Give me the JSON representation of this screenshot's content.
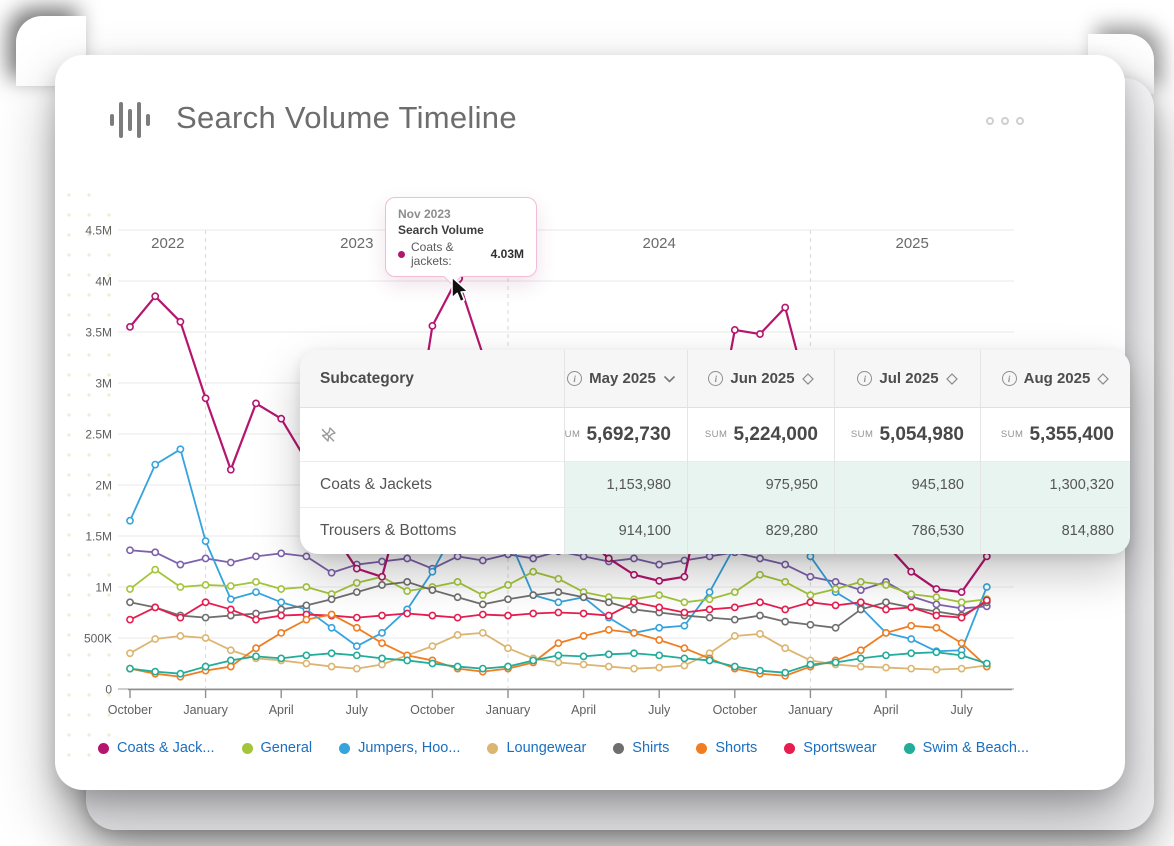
{
  "window": {
    "title": "Search Volume Timeline",
    "title_icon": "waveform-icon",
    "menu_icon": "three-dots-menu"
  },
  "tooltip": {
    "date": "Nov 2023",
    "label": "Search Volume",
    "series": "Coats & jackets:",
    "value": "4.03M",
    "accent_color": "#b5156e"
  },
  "table": {
    "first_column_header": "Subcategory",
    "sum_label": "SUM",
    "columns": [
      {
        "label": "May 2025",
        "sort_icon": "chevron-down",
        "sum": "5,692,730"
      },
      {
        "label": "Jun 2025",
        "sort_icon": "diamond-sort",
        "sum": "5,224,000"
      },
      {
        "label": "Jul 2025",
        "sort_icon": "diamond-sort",
        "sum": "5,054,980"
      },
      {
        "label": "Aug 2025",
        "sort_icon": "diamond-sort",
        "sum": "5,355,400"
      }
    ],
    "rows": [
      {
        "name": "Coats & Jackets",
        "values": [
          "1,153,980",
          "975,950",
          "945,180",
          "1,300,320"
        ]
      },
      {
        "name": "Trousers & Bottoms",
        "values": [
          "914,100",
          "829,280",
          "786,530",
          "814,880"
        ]
      }
    ]
  },
  "legend": {
    "items": [
      {
        "label": "Coats & Jack...",
        "color": "#b5156e"
      },
      {
        "label": "General",
        "color": "#a3c53a"
      },
      {
        "label": "Jumpers, Hoo...",
        "color": "#35a3dd"
      },
      {
        "label": "Loungewear",
        "color": "#dcb571"
      },
      {
        "label": "Shirts",
        "color": "#6f6f6f"
      },
      {
        "label": "Shorts",
        "color": "#ef7e23"
      },
      {
        "label": "Sportswear",
        "color": "#e61e50"
      },
      {
        "label": "Swim & Beach...",
        "color": "#23ac99"
      }
    ]
  },
  "chart_data": {
    "type": "line",
    "title": "Search Volume Timeline",
    "ylabel": "Search Volume",
    "ylim": [
      0,
      4500000
    ],
    "values_unit": "millions",
    "grid": true,
    "y_tick_labels": [
      "4.5M",
      "4M",
      "3.5M",
      "3M",
      "2.5M",
      "2M",
      "1.5M",
      "1M",
      "500K",
      "0"
    ],
    "x_tick_labels": [
      "October",
      "January",
      "April",
      "July",
      "October",
      "January",
      "April",
      "July",
      "October",
      "January",
      "April",
      "July"
    ],
    "year_labels": [
      "2022",
      "2023",
      "2024",
      "2025"
    ],
    "x_start_month": "Oct 2022",
    "x_end_month": "Aug 2025",
    "highlight_point": {
      "series": "Coats & Jackets",
      "month": "Nov 2023",
      "value_m": 4.03
    },
    "series": [
      {
        "name": "Coats & Jackets",
        "color": "#b5156e",
        "width": 2.2,
        "values_m": [
          3.55,
          3.85,
          3.6,
          2.85,
          2.15,
          2.8,
          2.65,
          2.24,
          1.55,
          1.18,
          1.1,
          2.0,
          3.56,
          4.03,
          3.28,
          2.6,
          2.05,
          1.72,
          1.5,
          1.28,
          1.12,
          1.06,
          1.1,
          2.2,
          3.52,
          3.48,
          3.74,
          2.8,
          2.15,
          1.68,
          1.42,
          1.15,
          0.98,
          0.95,
          1.3
        ]
      },
      {
        "name": "Trousers & Bottoms",
        "color": "#7e62ad",
        "width": 1.8,
        "values_m": [
          1.36,
          1.34,
          1.22,
          1.28,
          1.24,
          1.3,
          1.33,
          1.3,
          1.14,
          1.22,
          1.25,
          1.28,
          1.18,
          1.3,
          1.26,
          1.32,
          1.28,
          1.35,
          1.3,
          1.25,
          1.28,
          1.22,
          1.26,
          1.3,
          1.34,
          1.28,
          1.22,
          1.1,
          1.05,
          0.97,
          1.05,
          0.91,
          0.83,
          0.79,
          0.81
        ]
      },
      {
        "name": "Jumpers, Hoodies & Sweatshirts",
        "color": "#35a3dd",
        "width": 1.8,
        "values_m": [
          1.65,
          2.2,
          2.35,
          1.45,
          0.88,
          0.95,
          0.85,
          0.78,
          0.6,
          0.42,
          0.55,
          0.78,
          1.15,
          1.6,
          2.1,
          1.5,
          0.92,
          0.85,
          0.9,
          0.7,
          0.55,
          0.6,
          0.62,
          0.95,
          1.4,
          2.05,
          1.85,
          1.3,
          0.95,
          0.8,
          0.55,
          0.49,
          0.37,
          0.38,
          1.0
        ]
      },
      {
        "name": "General",
        "color": "#a3c53a",
        "width": 1.8,
        "values_m": [
          0.98,
          1.17,
          1.0,
          1.02,
          1.01,
          1.05,
          0.98,
          1.0,
          0.93,
          1.04,
          1.1,
          0.96,
          1.0,
          1.05,
          0.92,
          1.02,
          1.15,
          1.08,
          0.95,
          0.9,
          0.88,
          0.92,
          0.85,
          0.88,
          0.95,
          1.12,
          1.05,
          0.92,
          0.98,
          1.05,
          1.02,
          0.93,
          0.9,
          0.85,
          0.88
        ]
      },
      {
        "name": "Shirts",
        "color": "#6f6f6f",
        "width": 1.8,
        "values_m": [
          0.85,
          0.8,
          0.72,
          0.7,
          0.72,
          0.74,
          0.78,
          0.82,
          0.88,
          0.95,
          1.02,
          1.05,
          0.97,
          0.9,
          0.83,
          0.88,
          0.92,
          0.95,
          0.9,
          0.85,
          0.78,
          0.75,
          0.72,
          0.7,
          0.68,
          0.72,
          0.66,
          0.63,
          0.6,
          0.78,
          0.85,
          0.8,
          0.76,
          0.72,
          0.85
        ]
      },
      {
        "name": "Sportswear",
        "color": "#e61e50",
        "width": 1.8,
        "values_m": [
          0.68,
          0.8,
          0.7,
          0.85,
          0.78,
          0.68,
          0.72,
          0.73,
          0.72,
          0.7,
          0.72,
          0.74,
          0.72,
          0.7,
          0.73,
          0.72,
          0.74,
          0.75,
          0.74,
          0.72,
          0.85,
          0.8,
          0.75,
          0.78,
          0.8,
          0.85,
          0.78,
          0.85,
          0.82,
          0.85,
          0.78,
          0.8,
          0.72,
          0.7,
          0.87
        ]
      },
      {
        "name": "Loungewear",
        "color": "#dcb571",
        "width": 1.8,
        "values_m": [
          0.35,
          0.49,
          0.52,
          0.5,
          0.38,
          0.3,
          0.28,
          0.25,
          0.22,
          0.2,
          0.24,
          0.33,
          0.42,
          0.53,
          0.55,
          0.4,
          0.3,
          0.26,
          0.24,
          0.22,
          0.2,
          0.21,
          0.23,
          0.35,
          0.52,
          0.54,
          0.4,
          0.28,
          0.24,
          0.22,
          0.21,
          0.2,
          0.19,
          0.2,
          0.23
        ]
      },
      {
        "name": "Shorts",
        "color": "#ef7e23",
        "width": 1.8,
        "values_m": [
          0.2,
          0.15,
          0.12,
          0.18,
          0.22,
          0.4,
          0.55,
          0.68,
          0.73,
          0.6,
          0.45,
          0.33,
          0.28,
          0.2,
          0.17,
          0.2,
          0.26,
          0.45,
          0.52,
          0.58,
          0.55,
          0.48,
          0.4,
          0.3,
          0.2,
          0.15,
          0.13,
          0.22,
          0.28,
          0.38,
          0.55,
          0.62,
          0.6,
          0.45,
          0.22
        ]
      },
      {
        "name": "Swim & Beachwear",
        "color": "#23ac99",
        "width": 1.8,
        "values_m": [
          0.2,
          0.17,
          0.15,
          0.22,
          0.28,
          0.32,
          0.3,
          0.33,
          0.35,
          0.33,
          0.3,
          0.28,
          0.25,
          0.22,
          0.2,
          0.22,
          0.28,
          0.33,
          0.32,
          0.34,
          0.35,
          0.33,
          0.3,
          0.28,
          0.22,
          0.18,
          0.16,
          0.24,
          0.26,
          0.3,
          0.33,
          0.35,
          0.36,
          0.33,
          0.25
        ]
      }
    ]
  }
}
